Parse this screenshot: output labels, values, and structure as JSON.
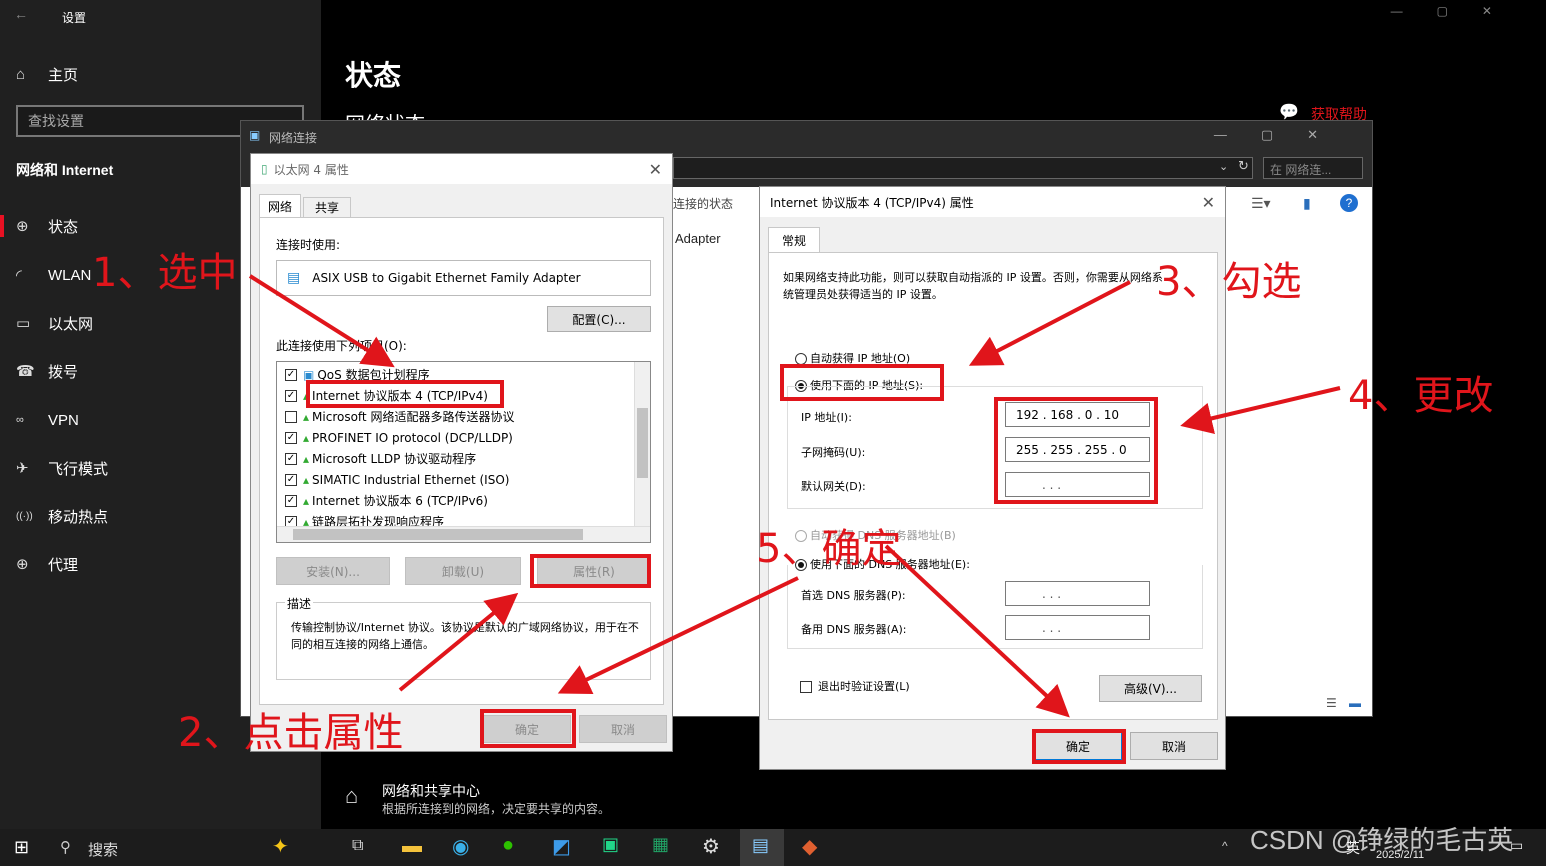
{
  "settings": {
    "window_title": "设置",
    "home_label": "主页",
    "search_placeholder": "查找设置",
    "category": "网络和 Internet",
    "nav_items": [
      {
        "icon": "status-icon",
        "glyph": "⊕",
        "label": "状态"
      },
      {
        "icon": "wlan-icon",
        "glyph": "◜",
        "label": "WLAN"
      },
      {
        "icon": "ethernet-icon",
        "glyph": "▭",
        "label": "以太网"
      },
      {
        "icon": "dialup-icon",
        "glyph": "☎",
        "label": "拨号"
      },
      {
        "icon": "vpn-icon",
        "glyph": "∞",
        "label": "VPN"
      },
      {
        "icon": "airplane-icon",
        "glyph": "✈",
        "label": "飞行模式"
      },
      {
        "icon": "hotspot-icon",
        "glyph": "((·))",
        "label": "移动热点"
      },
      {
        "icon": "proxy-icon",
        "glyph": "⊕",
        "label": "代理"
      }
    ],
    "page_title": "状态",
    "section_title": "网络状态",
    "help_link": "获取帮助",
    "sharing_center_title": "网络和共享中心",
    "sharing_center_desc": "根据所连接到的网络，决定要共享的内容。"
  },
  "netconn": {
    "title": "网络连接",
    "search_placeholder": "在 网络连...",
    "col_status": "连接的状态",
    "adapter_text": "Adapter"
  },
  "eth_props": {
    "title": "以太网 4 属性",
    "tab_network": "网络",
    "tab_share": "共享",
    "connect_using_label": "连接时使用:",
    "adapter_name": "ASIX USB to Gigabit Ethernet Family Adapter",
    "configure_button": "配置(C)...",
    "items_label": "此连接使用下列项目(O):",
    "items": [
      {
        "checked": true,
        "label": "QoS 数据包计划程序"
      },
      {
        "checked": true,
        "label": "Internet 协议版本 4 (TCP/IPv4)"
      },
      {
        "checked": false,
        "label": "Microsoft 网络适配器多路传送器协议"
      },
      {
        "checked": true,
        "label": "PROFINET IO protocol (DCP/LLDP)"
      },
      {
        "checked": true,
        "label": "Microsoft LLDP 协议驱动程序"
      },
      {
        "checked": true,
        "label": "SIMATIC Industrial Ethernet (ISO)"
      },
      {
        "checked": true,
        "label": "Internet 协议版本 6 (TCP/IPv6)"
      },
      {
        "checked": true,
        "label": "链路层拓扑发现响应程序"
      }
    ],
    "install_button": "安装(N)...",
    "uninstall_button": "卸载(U)",
    "properties_button": "属性(R)",
    "desc_label": "描述",
    "desc_text": "传输控制协议/Internet 协议。该协议是默认的广域网络协议，用于在不同的相互连接的网络上通信。",
    "ok_button": "确定",
    "cancel_button": "取消"
  },
  "ipv4": {
    "title": "Internet 协议版本 4 (TCP/IPv4) 属性",
    "tab_general": "常规",
    "intro": "如果网络支持此功能，则可以获取自动指派的 IP 设置。否则，你需要从网络系统管理员处获得适当的 IP 设置。",
    "auto_ip": "自动获得 IP 地址(O)",
    "manual_ip": "使用下面的 IP 地址(S):",
    "ip_label": "IP 地址(I):",
    "ip_value": "192 . 168 .  0  .  10",
    "mask_label": "子网掩码(U):",
    "mask_value": "255 . 255 . 255 .  0",
    "gateway_label": "默认网关(D):",
    "gateway_value": ".       .       .",
    "auto_dns": "自动获得 DNS 服务器地址(B)",
    "manual_dns": "使用下面的 DNS 服务器地址(E):",
    "dns1_label": "首选 DNS 服务器(P):",
    "dns1_value": ".       .       .",
    "dns2_label": "备用 DNS 服务器(A):",
    "dns2_value": ".       .       .",
    "validate_label": "退出时验证设置(L)",
    "advanced_button": "高级(V)...",
    "ok_button": "确定",
    "cancel_button": "取消"
  },
  "annotations": {
    "step1": "1、选中",
    "step2": "2、点击属性",
    "step3": "3、勾选",
    "step4": "4、更改",
    "step5": "5、确定",
    "color": "#e0151b"
  },
  "taskbar": {
    "search_label": "搜索",
    "date": "2025/2/11",
    "input_method": "英",
    "watermark": "CSDN @铮绿的毛古英"
  }
}
